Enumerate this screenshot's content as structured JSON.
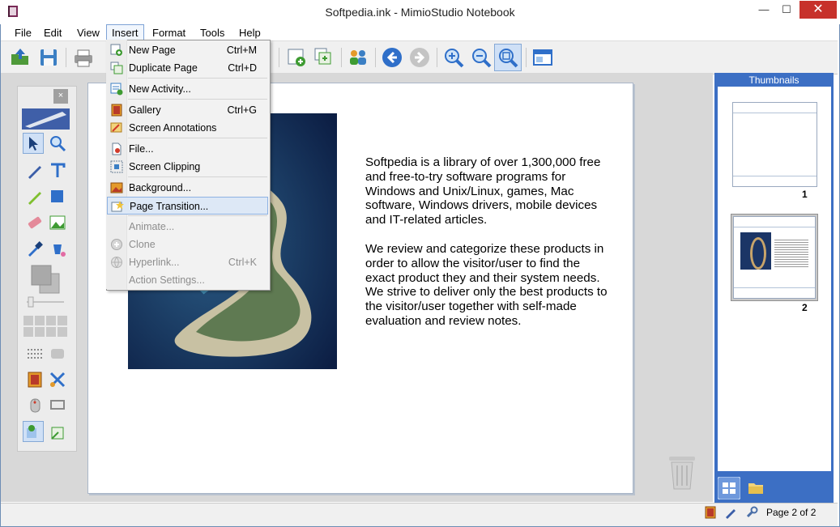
{
  "window": {
    "title": "Softpedia.ink - MimioStudio Notebook",
    "minimize_glyph": "—",
    "maximize_glyph": "☐",
    "close_glyph": "✕"
  },
  "menubar": {
    "items": [
      "File",
      "Edit",
      "View",
      "Insert",
      "Format",
      "Tools",
      "Help"
    ],
    "active": "Insert"
  },
  "insert_menu": {
    "items": [
      {
        "label": "New Page",
        "shortcut": "Ctrl+M",
        "enabled": true,
        "icon": "new-page-icon"
      },
      {
        "label": "Duplicate Page",
        "shortcut": "Ctrl+D",
        "enabled": true,
        "icon": "duplicate-page-icon"
      },
      {
        "label": "New Activity...",
        "shortcut": "",
        "enabled": true,
        "icon": "new-activity-icon"
      },
      {
        "label": "Gallery",
        "shortcut": "Ctrl+G",
        "enabled": true,
        "icon": "gallery-icon"
      },
      {
        "label": "Screen Annotations",
        "shortcut": "",
        "enabled": true,
        "icon": "screen-annotations-icon"
      },
      {
        "label": "File...",
        "shortcut": "",
        "enabled": true,
        "icon": "file-icon"
      },
      {
        "label": "Screen Clipping",
        "shortcut": "",
        "enabled": true,
        "icon": "screen-clipping-icon"
      },
      {
        "label": "Background...",
        "shortcut": "",
        "enabled": true,
        "icon": "background-icon"
      },
      {
        "label": "Page Transition...",
        "shortcut": "",
        "enabled": true,
        "icon": "page-transition-icon",
        "highlighted": true
      },
      {
        "label": "Animate...",
        "shortcut": "",
        "enabled": false
      },
      {
        "label": "Clone",
        "shortcut": "",
        "enabled": false,
        "icon": "clone-icon"
      },
      {
        "label": "Hyperlink...",
        "shortcut": "Ctrl+K",
        "enabled": false,
        "icon": "hyperlink-icon"
      },
      {
        "label": "Action Settings...",
        "shortcut": "",
        "enabled": false
      }
    ]
  },
  "page": {
    "paragraph_1": "Softpedia is a library of over 1,300,000 free and free-to-try software programs for Windows and Unix/Linux, games, Mac software, Windows drivers, mobile devices and IT-related articles.",
    "paragraph_2": "We review and categorize these products in order to allow the visitor/user to find the exact product they and their system needs. We strive to deliver only the best products to the visitor/user together with self-made evaluation and review notes."
  },
  "palette": {
    "close_glyph": "×"
  },
  "thumbnails": {
    "title": "Thumbnails",
    "pages": [
      {
        "label": "1"
      },
      {
        "label": "2",
        "selected": true
      }
    ]
  },
  "status": {
    "page_indicator": "Page 2 of 2"
  },
  "colors": {
    "accent_blue": "#3c6fc4",
    "close_red": "#c7312b",
    "menu_highlight": "#dde8f6"
  }
}
